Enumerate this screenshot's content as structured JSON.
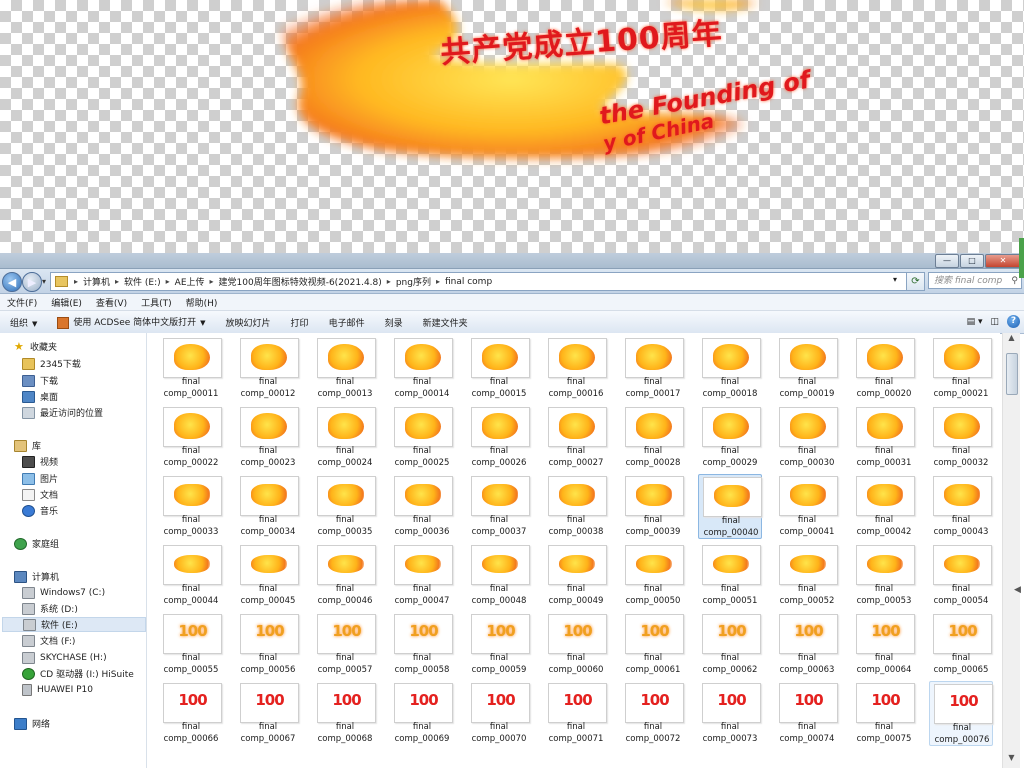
{
  "preview": {
    "line1": "共产党成立100周年",
    "line2": "the Founding of",
    "line3": "y of China"
  },
  "window": {
    "buttons": {
      "minimize": "—",
      "maximize": "□",
      "close": "✕"
    }
  },
  "address": {
    "crumbs": [
      "计算机",
      "软件 (E:)",
      "AE上传",
      "建党100周年图标特效视频-6(2021.4.8)",
      "png序列",
      "final comp"
    ],
    "search_placeholder": "搜索 final comp"
  },
  "menu": [
    "文件(F)",
    "编辑(E)",
    "查看(V)",
    "工具(T)",
    "帮助(H)"
  ],
  "toolbar": {
    "organize": "组织",
    "open_with": "使用 ACDSee 简体中文版打开",
    "slideshow": "放映幻灯片",
    "print": "打印",
    "email": "电子邮件",
    "burn": "刻录",
    "new_folder": "新建文件夹"
  },
  "nav": {
    "favorites": "收藏夹",
    "fav_items": [
      "2345下载",
      "下载",
      "桌面",
      "最近访问的位置"
    ],
    "libraries": "库",
    "lib_items": [
      "视频",
      "图片",
      "文档",
      "音乐"
    ],
    "homegroup": "家庭组",
    "computer": "计算机",
    "drives": [
      "Windows7 (C:)",
      "系统 (D:)",
      "软件 (E:)",
      "文档 (F:)",
      "SKYCHASE (H:)",
      "CD 驱动器 (I:) HiSuite",
      "HUAWEI P10"
    ],
    "network": "网络"
  },
  "files": {
    "name_prefix": "final",
    "numbers": [
      "comp_00011",
      "comp_00012",
      "comp_00013",
      "comp_00014",
      "comp_00015",
      "comp_00016",
      "comp_00017",
      "comp_00018",
      "comp_00019",
      "comp_00020",
      "comp_00021",
      "comp_00022",
      "comp_00023",
      "comp_00024",
      "comp_00025",
      "comp_00026",
      "comp_00027",
      "comp_00028",
      "comp_00029",
      "comp_00030",
      "comp_00031",
      "comp_00032",
      "comp_00033",
      "comp_00034",
      "comp_00035",
      "comp_00036",
      "comp_00037",
      "comp_00038",
      "comp_00039",
      "comp_00040",
      "comp_00041",
      "comp_00042",
      "comp_00043",
      "comp_00044",
      "comp_00045",
      "comp_00046",
      "comp_00047",
      "comp_00048",
      "comp_00049",
      "comp_00050",
      "comp_00051",
      "comp_00052",
      "comp_00053",
      "comp_00054",
      "comp_00055",
      "comp_00056",
      "comp_00057",
      "comp_00058",
      "comp_00059",
      "comp_00060",
      "comp_00061",
      "comp_00062",
      "comp_00063",
      "comp_00064",
      "comp_00065",
      "comp_00066",
      "comp_00067",
      "comp_00068",
      "comp_00069",
      "comp_00070",
      "comp_00071",
      "comp_00072",
      "comp_00073",
      "comp_00074",
      "comp_00075",
      "comp_00076"
    ],
    "selected": "comp_00040",
    "hover": "comp_00076",
    "thumb_glyph": "100"
  },
  "colors": {
    "accent": "#e4211f",
    "flame": "#ffb319",
    "selection": "#d8e8f8"
  }
}
